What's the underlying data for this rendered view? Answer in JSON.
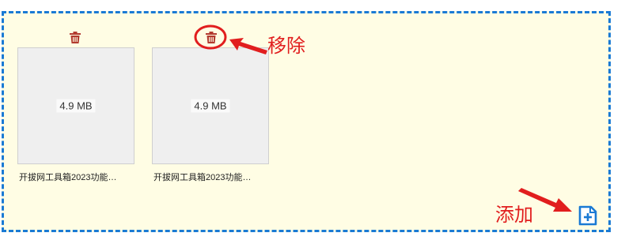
{
  "files": [
    {
      "size": "4.9 MB",
      "name": "开拔网工具箱2023功能…"
    },
    {
      "size": "4.9 MB",
      "name": "开拔网工具箱2023功能…"
    }
  ],
  "annotations": {
    "remove_label": "移除",
    "add_label": "添加"
  },
  "icons": {
    "remove": "trash-icon",
    "add": "file-add-icon"
  },
  "colors": {
    "dropzone_bg": "#fffde4",
    "dropzone_border": "#1a7ad4",
    "trash": "#b23a2f",
    "annotation": "#e11e1e",
    "add_icon": "#1a7ad4"
  }
}
